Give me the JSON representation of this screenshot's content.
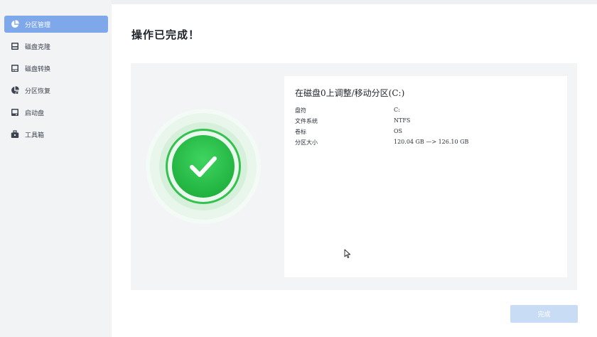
{
  "sidebar": {
    "items": [
      {
        "label": "分区管理",
        "icon": "pie-chart-icon",
        "active": true
      },
      {
        "label": "磁盘克隆",
        "icon": "disk-clone-icon",
        "active": false
      },
      {
        "label": "磁盘转换",
        "icon": "disk-convert-icon",
        "active": false
      },
      {
        "label": "分区恢复",
        "icon": "partition-recovery-icon",
        "active": false
      },
      {
        "label": "启动盘",
        "icon": "boot-disk-icon",
        "active": false
      },
      {
        "label": "工具箱",
        "icon": "toolbox-icon",
        "active": false
      }
    ]
  },
  "main": {
    "title": "操作已完成！",
    "status_icon": "success-check-icon",
    "details": {
      "title": "在磁盘0上调整/移动分区(C:)",
      "rows": [
        {
          "key": "盘符",
          "value": "C:"
        },
        {
          "key": "文件系统",
          "value": "NTFS"
        },
        {
          "key": "卷标",
          "value": "OS"
        },
        {
          "key": "分区大小",
          "value": "120.04 GB —> 126.10 GB"
        }
      ]
    },
    "finish_label": "完成"
  },
  "colors": {
    "accent": "#7fa8ea",
    "success": "#22b441",
    "button_disabled": "#c9dcf5"
  }
}
